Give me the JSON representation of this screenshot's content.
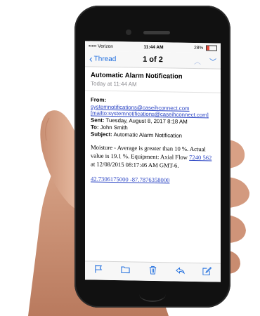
{
  "status_bar": {
    "carrier": "••••• Verizon",
    "time": "11:44 AM",
    "battery": "28%"
  },
  "nav": {
    "back_label": "Thread",
    "position": "1 of 2"
  },
  "message": {
    "subject": "Automatic Alarm Notification",
    "received": "Today at 11:44 AM",
    "from_label": "From:",
    "from_email": "systemnotifications@caseihconnect.com",
    "from_mailto": "[mailto:systemnotifications@caseihconnect.com]",
    "sent_label": "Sent:",
    "sent_value": "Tuesday, August 8, 2017 8:18 AM",
    "to_label": "To:",
    "to_value": "John Smith",
    "subject_label": "Subject:",
    "subject_value": "Automatic Alarm Notification",
    "body_text_1": "Moisture - Average is greater than 10 %. Actual value is 19.1 %. Equipment: Axial Flow",
    "body_link": "7240 562",
    "body_text_2": "at 12/08/2015 08:17:46 AM GMT-6.",
    "coordinates": "42.7306175000 -87.7876358000"
  },
  "toolbar": [
    "flag-icon",
    "folder-icon",
    "trash-icon",
    "reply-icon",
    "compose-icon"
  ],
  "colors": {
    "link": "#2a44c4",
    "ios_blue": "#1e6dde",
    "battery_low": "#e64a3a"
  }
}
